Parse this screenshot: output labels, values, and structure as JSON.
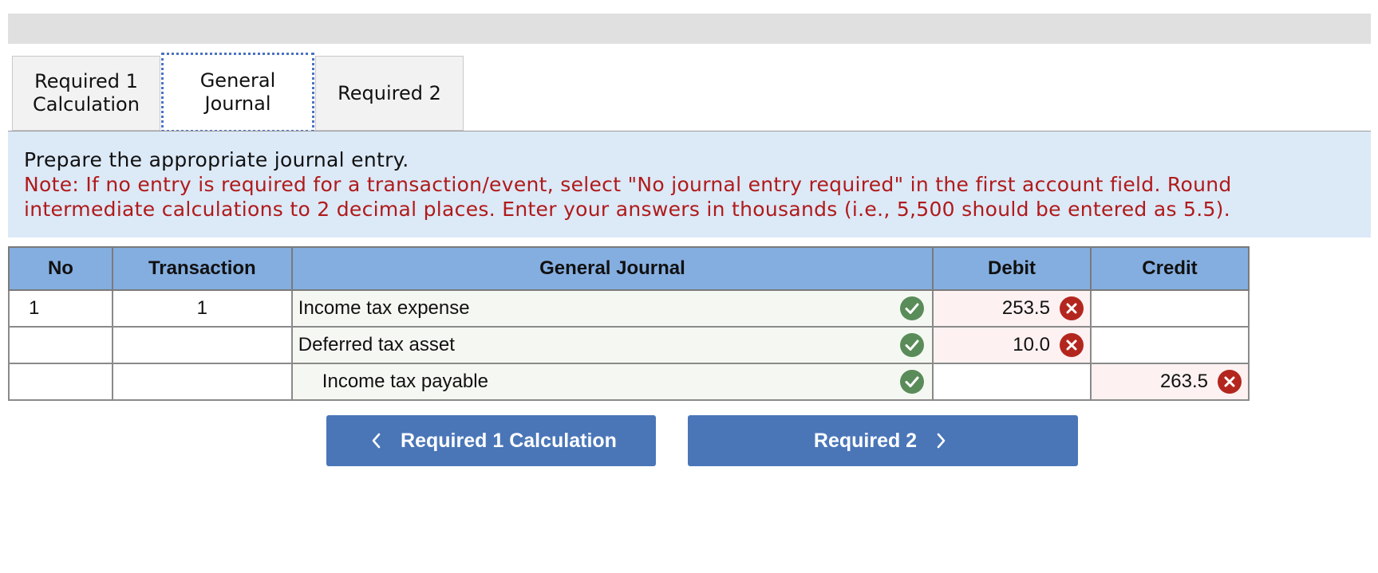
{
  "tabs": [
    {
      "label": "Required 1\nCalculation"
    },
    {
      "label": "General\nJournal"
    },
    {
      "label": "Required 2"
    }
  ],
  "instructions": {
    "main": "Prepare the appropriate journal entry.",
    "note": "Note: If no entry is required for a transaction/event, select \"No journal entry required\" in the first account field. Round intermediate calculations to 2 decimal places. Enter your answers in thousands (i.e., 5,500 should be entered as 5.5)."
  },
  "table": {
    "headers": [
      "No",
      "Transaction",
      "General Journal",
      "Debit",
      "Credit"
    ],
    "rows": [
      {
        "no": "1",
        "transaction": "1",
        "account": "Income tax expense",
        "debit": "253.5",
        "credit": ""
      },
      {
        "no": "",
        "transaction": "",
        "account": "Deferred tax asset",
        "debit": "10.0",
        "credit": ""
      },
      {
        "no": "",
        "transaction": "",
        "account": "Income tax payable",
        "debit": "",
        "credit": "263.5"
      }
    ]
  },
  "nav": {
    "prev_label": "Required 1 Calculation",
    "next_label": "Required 2"
  },
  "colors": {
    "header_blue": "#84aee0",
    "panel_blue": "#dce9f7",
    "note_red": "#b01a1a",
    "correct_green": "#5a8c5a",
    "error_red": "#b3261e",
    "button_blue": "#4a76b8"
  },
  "icons": {
    "correct": "check-circle-icon",
    "incorrect": "x-circle-icon",
    "prev": "chevron-left-icon",
    "next": "chevron-right-icon"
  }
}
